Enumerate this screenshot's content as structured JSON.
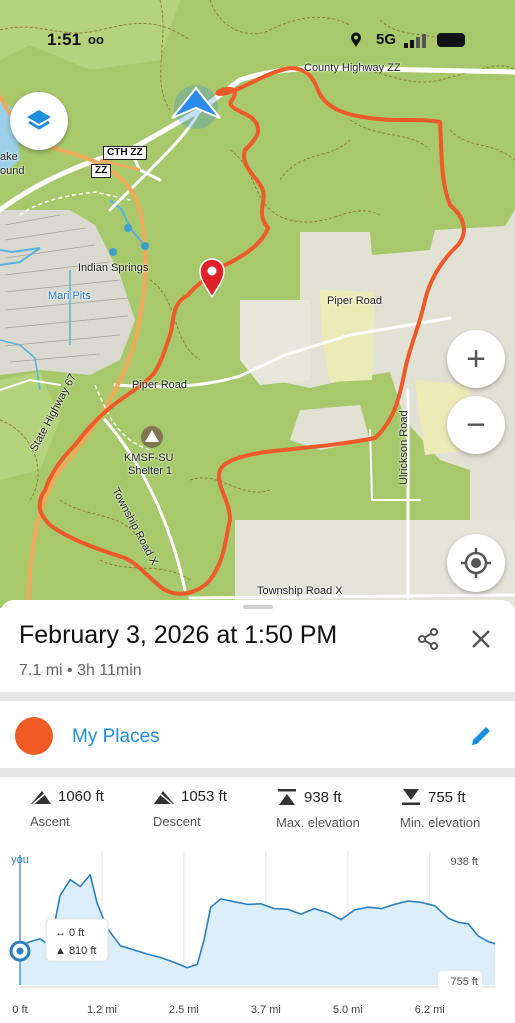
{
  "status": {
    "time": "1:51",
    "voicemail": "oo",
    "network": "5G"
  },
  "map": {
    "labels": {
      "county_highway": "County Highway ZZ",
      "lake": "ake",
      "lake2": "ound",
      "indian_springs": "Indian Springs",
      "mari_pits": "Mari Pits",
      "piper_road_east": "Piper Road",
      "piper_road_west": "Piper Road",
      "state_highway": "State Highway 67",
      "shelter_1": "KMSF-SU",
      "shelter_2": "Shelter 1",
      "township_road": "Township Road X",
      "township_road_x": "Township Road X",
      "ulrickson_road": "Ulrickson Road"
    },
    "shields": {
      "cth": "CTH ZZ",
      "zz": "ZZ"
    },
    "buttons": {
      "zoom_in": "+",
      "zoom_out": "−"
    }
  },
  "sheet": {
    "title": "February 3, 2026 at 1:50 PM",
    "subtitle": "7.1 mi • 3h 11min",
    "place": {
      "label": "My Places",
      "color": "#f05a24"
    }
  },
  "stats": [
    {
      "value": "1060 ft",
      "label": "Ascent",
      "icon": "ascent-icon"
    },
    {
      "value": "1053 ft",
      "label": "Descent",
      "icon": "descent-icon"
    },
    {
      "value": "938 ft",
      "label": "Max. elevation",
      "icon": "max-elevation-icon"
    },
    {
      "value": "755 ft",
      "label": "Min. elevation",
      "icon": "min-elevation-icon"
    }
  ],
  "chart_data": {
    "type": "area",
    "title": "",
    "xlabel": "",
    "ylabel": "",
    "x_ticks": [
      "0 ft",
      "1.2 mi",
      "2.5 mi",
      "3.7 mi",
      "5.0 mi",
      "6.2 mi"
    ],
    "xlim": [
      0,
      7.1
    ],
    "ylim": [
      755,
      938
    ],
    "y_annotations": {
      "max": "938 ft",
      "min": "755 ft"
    },
    "cursor": {
      "label": "you",
      "distance": "0 ft",
      "elevation": "810 ft"
    },
    "series": [
      {
        "x": [
          0,
          0.15,
          0.3,
          0.45,
          0.6,
          0.75,
          0.9,
          1.05,
          1.15,
          1.3,
          1.5,
          1.7,
          1.9,
          2.1,
          2.3,
          2.5,
          2.65,
          2.75,
          2.85,
          3.0,
          3.2,
          3.4,
          3.6,
          3.8,
          4.0,
          4.2,
          4.4,
          4.6,
          4.8,
          5.0,
          5.2,
          5.4,
          5.6,
          5.8,
          6.0,
          6.2,
          6.4,
          6.55,
          6.7,
          6.85,
          7.0,
          7.1
        ],
        "y": [
          810,
          818,
          822,
          812,
          885,
          908,
          898,
          915,
          875,
          838,
          812,
          806,
          800,
          795,
          788,
          780,
          785,
          820,
          868,
          880,
          876,
          872,
          873,
          866,
          865,
          858,
          866,
          860,
          850,
          864,
          868,
          866,
          872,
          877,
          875,
          870,
          852,
          846,
          844,
          826,
          818,
          815
        ]
      }
    ]
  }
}
